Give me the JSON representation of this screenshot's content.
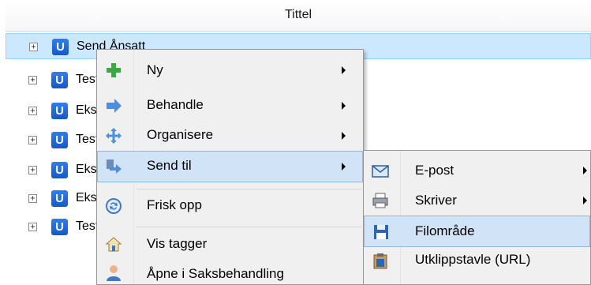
{
  "header": {
    "title": "Tittel"
  },
  "tree_rows": [
    {
      "label": "Send Ånsatt"
    },
    {
      "label": "Test"
    },
    {
      "label": "Eksport"
    },
    {
      "label": "Test"
    },
    {
      "label": "Eksport"
    },
    {
      "label": "Eksport"
    },
    {
      "label": "Test"
    }
  ],
  "context_menu": {
    "items": [
      {
        "label": "Ny",
        "icon": "plus-icon",
        "submenu": true
      },
      {
        "label": "Behandle",
        "icon": "arrow-right-icon",
        "submenu": true
      },
      {
        "label": "Organisere",
        "icon": "move-icon",
        "submenu": true
      },
      {
        "label": "Send til",
        "icon": "send-icon",
        "submenu": true,
        "highlighted": true
      },
      {
        "label": "Frisk opp",
        "icon": "refresh-icon",
        "submenu": false
      },
      {
        "label": "Vis tagger",
        "icon": "tag-house-icon",
        "submenu": false
      },
      {
        "label": "Åpne i Saksbehandling",
        "icon": "person-icon",
        "submenu": false
      }
    ]
  },
  "submenu": {
    "items": [
      {
        "label": "E-post",
        "icon": "envelope-icon",
        "submenu": true
      },
      {
        "label": "Skriver",
        "icon": "printer-icon",
        "submenu": true
      },
      {
        "label": "Filområde",
        "icon": "floppy-icon",
        "submenu": false,
        "highlighted": true
      },
      {
        "label": "Utklippstavle (URL)",
        "icon": "clipboard-icon",
        "submenu": false
      }
    ]
  },
  "colors": {
    "selection": "#cce8ff",
    "menu_bg": "#f0f0f0",
    "menu_highlight": "#d1e4f7",
    "brand_u": "#1e6ae0"
  }
}
